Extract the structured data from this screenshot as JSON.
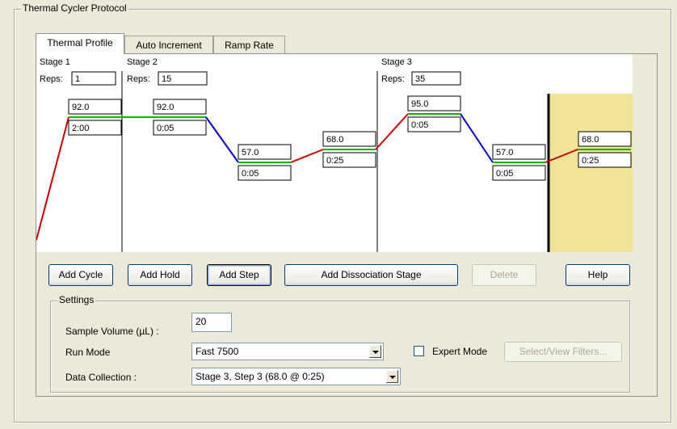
{
  "window": {
    "group_title": "Thermal Cycler Protocol"
  },
  "tabs": [
    {
      "label": "Thermal Profile",
      "active": true
    },
    {
      "label": "Auto Increment",
      "active": false
    },
    {
      "label": "Ramp Rate",
      "active": false
    }
  ],
  "stages": [
    {
      "name": "Stage 1",
      "reps_label": "Reps:",
      "reps": "1"
    },
    {
      "name": "Stage 2",
      "reps_label": "Reps:",
      "reps": "15"
    },
    {
      "name": "Stage 3",
      "reps_label": "Reps:",
      "reps": "35"
    }
  ],
  "steps": [
    {
      "temp": "92.0",
      "time": "2:00"
    },
    {
      "temp": "92.0",
      "time": "0:05"
    },
    {
      "temp": "57.0",
      "time": "0:05"
    },
    {
      "temp": "68.0",
      "time": "0:25"
    },
    {
      "temp": "95.0",
      "time": "0:05"
    },
    {
      "temp": "57.0",
      "time": "0:05"
    },
    {
      "temp": "68.0",
      "time": "0:25"
    }
  ],
  "colors": {
    "ramp_up": "#c80000",
    "ramp_down": "#0000c8",
    "hold": "#00b400",
    "dissociation_bg": "#f0e496",
    "divider": "#000000"
  },
  "buttons": {
    "add_cycle": "Add Cycle",
    "add_hold": "Add Hold",
    "add_step": "Add Step",
    "add_dissociation": "Add Dissociation Stage",
    "delete": "Delete",
    "help": "Help"
  },
  "settings": {
    "title": "Settings",
    "sample_volume_label": "Sample Volume (µL) :",
    "sample_volume": "20",
    "run_mode_label": "Run Mode",
    "run_mode": "Fast 7500",
    "data_collection_label": "Data Collection :",
    "data_collection": "Stage 3, Step 3 (68.0 @ 0:25)",
    "expert_mode_label": "Expert Mode",
    "expert_mode": false,
    "select_filters": "Select/View Filters..."
  }
}
